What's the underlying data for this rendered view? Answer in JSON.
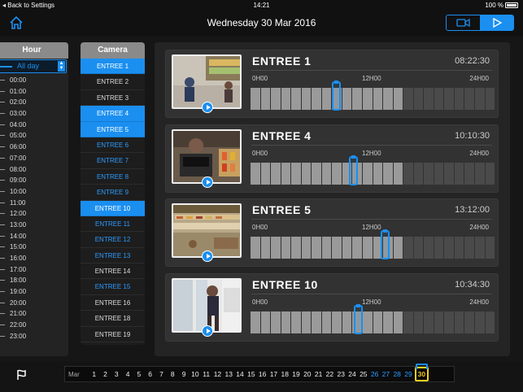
{
  "status": {
    "back": "Back to Settings",
    "time": "14:21",
    "battery": "100 %"
  },
  "header": {
    "title": "Wednesday 30 Mar 2016",
    "accent": "#1a8ff0"
  },
  "hours": {
    "title": "Hour",
    "all_day": "All day",
    "items": [
      "00:00",
      "01:00",
      "02:00",
      "03:00",
      "04:00",
      "05:00",
      "06:00",
      "07:00",
      "08:00",
      "09:00",
      "10:00",
      "11:00",
      "12:00",
      "13:00",
      "14:00",
      "15:00",
      "16:00",
      "17:00",
      "18:00",
      "19:00",
      "20:00",
      "21:00",
      "22:00",
      "23:00"
    ]
  },
  "cameras": {
    "title": "Camera",
    "items": [
      {
        "label": "ENTREE 1",
        "state": "selected"
      },
      {
        "label": "ENTREE 2",
        "state": "normal"
      },
      {
        "label": "ENTREE 3",
        "state": "normal"
      },
      {
        "label": "ENTREE 4",
        "state": "selected"
      },
      {
        "label": "ENTREE 5",
        "state": "selected"
      },
      {
        "label": "ENTREE 6",
        "state": "blue"
      },
      {
        "label": "ENTREE 7",
        "state": "blue"
      },
      {
        "label": "ENTREE 8",
        "state": "blue"
      },
      {
        "label": "ENTREE 9",
        "state": "blue"
      },
      {
        "label": "ENTREE 10",
        "state": "selected"
      },
      {
        "label": "ENTREE 11",
        "state": "blue"
      },
      {
        "label": "ENTREE 12",
        "state": "blue"
      },
      {
        "label": "ENTREE 13",
        "state": "blue"
      },
      {
        "label": "ENTREE 14",
        "state": "normal"
      },
      {
        "label": "ENTREE 15",
        "state": "blue"
      },
      {
        "label": "ENTREE 16",
        "state": "normal"
      },
      {
        "label": "ENTREE 18",
        "state": "normal"
      },
      {
        "label": "ENTREE 19",
        "state": "normal"
      }
    ]
  },
  "timeline_labels": {
    "start": "0H00",
    "mid": "12H00",
    "end": "24H00"
  },
  "cards": [
    {
      "name": "ENTREE 1",
      "time": "08:22:30",
      "scene": "store-aisle",
      "recorded_fraction": 0.62,
      "cursor_fraction": 0.35
    },
    {
      "name": "ENTREE 4",
      "time": "10:10:30",
      "scene": "checkout",
      "recorded_fraction": 0.62,
      "cursor_fraction": 0.42
    },
    {
      "name": "ENTREE 5",
      "time": "13:12:00",
      "scene": "deli-counter",
      "recorded_fraction": 0.62,
      "cursor_fraction": 0.55
    },
    {
      "name": "ENTREE 10",
      "time": "10:34:30",
      "scene": "doorway",
      "recorded_fraction": 0.62,
      "cursor_fraction": 0.44
    }
  ],
  "datebar": {
    "month": "Mar",
    "days": [
      "1",
      "2",
      "3",
      "4",
      "5",
      "6",
      "7",
      "8",
      "9",
      "10",
      "11",
      "12",
      "13",
      "14",
      "15",
      "16",
      "17",
      "18",
      "19",
      "20",
      "21",
      "22",
      "23",
      "24",
      "25",
      "26",
      "27",
      "28",
      "29",
      "30"
    ],
    "future_days": [
      "26",
      "27",
      "28",
      "29"
    ],
    "selected_day": "30"
  }
}
